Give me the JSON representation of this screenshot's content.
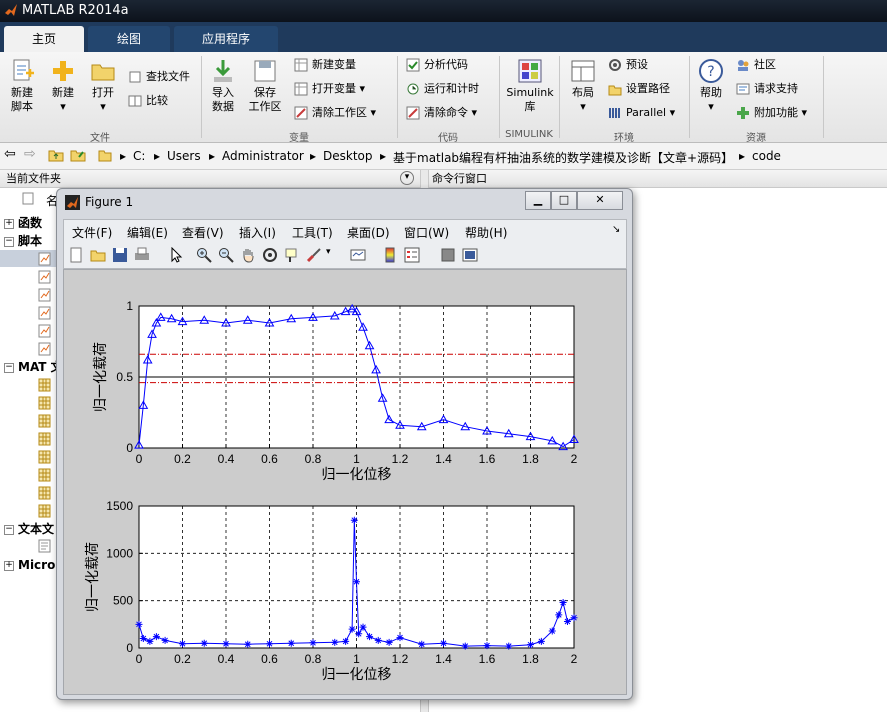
{
  "window": {
    "title": "MATLAB R2014a"
  },
  "tabs": [
    {
      "label": "主页"
    },
    {
      "label": "绘图"
    },
    {
      "label": "应用程序"
    }
  ],
  "ribbon": {
    "file": {
      "group_label": "文件",
      "new_script_line1": "新建",
      "new_script_line2": "脚本",
      "new_label": "新建",
      "open_label": "打开",
      "find_files": "查找文件",
      "compare": "比较"
    },
    "variable": {
      "group_label": "变量",
      "import_line1": "导入",
      "import_line2": "数据",
      "save_line1": "保存",
      "save_line2": "工作区",
      "new_variable": "新建变量",
      "open_variable": "打开变量",
      "clear_workspace": "清除工作区"
    },
    "code": {
      "group_label": "代码",
      "analyze": "分析代码",
      "run_time": "运行和计时",
      "clear_commands": "清除命令"
    },
    "simulink": {
      "group_label": "SIMULINK",
      "line1": "Simulink",
      "line2": "库"
    },
    "environment": {
      "group_label": "环境",
      "layout": "布局",
      "preferences": "预设",
      "set_path": "设置路径",
      "parallel": "Parallel"
    },
    "resources": {
      "group_label": "资源",
      "help": "帮助",
      "community": "社区",
      "request_support": "请求支持",
      "addons": "附加功能"
    }
  },
  "address": {
    "segments": [
      "C:",
      "Users",
      "Administrator",
      "Desktop",
      "基于matlab编程有杆抽油系统的数学建模及诊断【文章+源码】",
      "code"
    ]
  },
  "panels": {
    "current_folder": "当前文件夹",
    "command_window": "命令行窗口",
    "name_col": "名"
  },
  "tree": [
    {
      "label": "函数",
      "expander": "+"
    },
    {
      "label": "脚本",
      "expander": "−"
    },
    {
      "label": "MAT 文",
      "expander": "−"
    },
    {
      "label": "文本文",
      "expander": "−"
    },
    {
      "label": "Micros",
      "expander": "+"
    }
  ],
  "figure": {
    "title": "Figure 1",
    "menu": [
      "文件(F)",
      "编辑(E)",
      "查看(V)",
      "插入(I)",
      "工具(T)",
      "桌面(D)",
      "窗口(W)",
      "帮助(H)"
    ],
    "toolbar_icons": [
      "new-figure-icon",
      "open-file-icon",
      "save-icon",
      "print-icon",
      "pointer-icon",
      "zoom-in-icon",
      "zoom-out-icon",
      "pan-icon",
      "rotate-icon",
      "data-cursor-icon",
      "brush-icon",
      "link-icon",
      "colorbar-icon",
      "legend-icon",
      "hide-tools-icon",
      "show-tools-icon"
    ],
    "colors": {
      "series": "#0000ff",
      "refline": "#cc0000",
      "grid": "#000000"
    }
  },
  "chart_data": [
    {
      "type": "line",
      "xlabel": "归一化位移",
      "ylabel": "归一化载荷",
      "xlim": [
        0,
        2
      ],
      "ylim": [
        0,
        1
      ],
      "xticks": [
        "0",
        "0.2",
        "0.4",
        "0.6",
        "0.8",
        "1",
        "1.2",
        "1.4",
        "1.6",
        "1.8",
        "2"
      ],
      "yticks": [
        "0",
        "0.5",
        "1"
      ],
      "grid": true,
      "marker": "triangle",
      "reference_lines": [
        {
          "y": 0.66,
          "style": "dash-dot",
          "color": "#cc0000"
        },
        {
          "y": 0.5,
          "style": "solid",
          "color": "#000000"
        },
        {
          "y": 0.46,
          "style": "dash-dot",
          "color": "#cc0000"
        }
      ],
      "x": [
        0,
        0.02,
        0.04,
        0.06,
        0.08,
        0.1,
        0.15,
        0.2,
        0.3,
        0.4,
        0.5,
        0.6,
        0.7,
        0.8,
        0.9,
        0.95,
        0.98,
        1.0,
        1.03,
        1.06,
        1.09,
        1.12,
        1.15,
        1.2,
        1.3,
        1.4,
        1.5,
        1.6,
        1.7,
        1.8,
        1.9,
        1.95,
        2.0
      ],
      "y": [
        0.02,
        0.3,
        0.62,
        0.8,
        0.88,
        0.92,
        0.91,
        0.89,
        0.9,
        0.88,
        0.9,
        0.88,
        0.91,
        0.92,
        0.93,
        0.96,
        0.98,
        0.96,
        0.85,
        0.72,
        0.55,
        0.35,
        0.2,
        0.16,
        0.15,
        0.2,
        0.15,
        0.12,
        0.1,
        0.08,
        0.05,
        0.01,
        0.06
      ]
    },
    {
      "type": "line",
      "xlabel": "归一化位移",
      "ylabel": "归一化载荷",
      "xlim": [
        0,
        2
      ],
      "ylim": [
        0,
        1500
      ],
      "xticks": [
        "0",
        "0.2",
        "0.4",
        "0.6",
        "0.8",
        "1",
        "1.2",
        "1.4",
        "1.6",
        "1.8",
        "2"
      ],
      "yticks": [
        "0",
        "500",
        "1000",
        "1500"
      ],
      "grid": true,
      "marker": "star",
      "x": [
        0,
        0.02,
        0.05,
        0.08,
        0.12,
        0.2,
        0.3,
        0.4,
        0.5,
        0.6,
        0.7,
        0.8,
        0.9,
        0.95,
        0.98,
        0.99,
        1.0,
        1.01,
        1.03,
        1.06,
        1.1,
        1.15,
        1.2,
        1.3,
        1.4,
        1.5,
        1.6,
        1.7,
        1.8,
        1.85,
        1.9,
        1.93,
        1.95,
        1.97,
        2.0
      ],
      "y": [
        250,
        100,
        70,
        120,
        80,
        45,
        50,
        45,
        40,
        45,
        50,
        55,
        60,
        70,
        200,
        1350,
        700,
        150,
        220,
        120,
        80,
        60,
        110,
        40,
        50,
        20,
        25,
        20,
        35,
        70,
        180,
        350,
        480,
        280,
        320
      ]
    }
  ]
}
